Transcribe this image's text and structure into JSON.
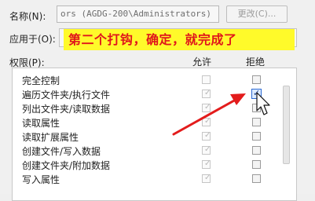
{
  "name_row": {
    "label": "名称(N):",
    "value": "ors (AGDG-200\\Administrators)",
    "change_button": "更改(C)..."
  },
  "apply_row": {
    "label": "应用于(O):",
    "banner_text": "第二个打钩，确定，就完成了"
  },
  "permissions": {
    "label": "权限(P):",
    "col_allow": "允许",
    "col_deny": "拒绝",
    "items": [
      {
        "name": "完全控制",
        "allow": false,
        "deny": false
      },
      {
        "name": "遍历文件夹/执行文件",
        "allow": true,
        "deny": true
      },
      {
        "name": "列出文件夹/读取数据",
        "allow": true,
        "deny": false
      },
      {
        "name": "读取属性",
        "allow": true,
        "deny": false
      },
      {
        "name": "读取扩展属性",
        "allow": true,
        "deny": false
      },
      {
        "name": "创建文件/写入数据",
        "allow": true,
        "deny": false
      },
      {
        "name": "创建文件夹/附加数据",
        "allow": true,
        "deny": false
      },
      {
        "name": "写入属性",
        "allow": true,
        "deny": false
      }
    ]
  },
  "colors": {
    "banner_bg": "#fffa2a",
    "banner_text": "#e0161b",
    "arrow": "#e31c1c"
  }
}
